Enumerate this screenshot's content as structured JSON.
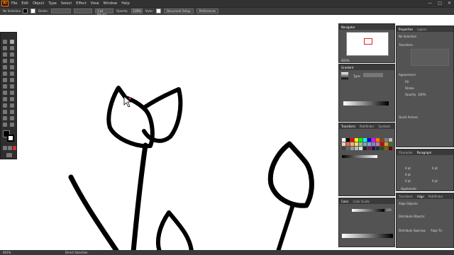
{
  "app": {
    "logo_text": "Ai"
  },
  "menubar": {
    "items": [
      "File",
      "Edit",
      "Object",
      "Type",
      "Select",
      "Effect",
      "View",
      "Window",
      "Help"
    ]
  },
  "window_controls": {
    "minimize": "—",
    "maximize": "□",
    "close": "✕"
  },
  "control_bar": {
    "selection_label": "No Selection",
    "stroke_label": "Stroke:",
    "brush_value": "3 pt. Round",
    "opacity_label": "Opacity:",
    "opacity_value": "100%",
    "style_label": "Style:",
    "document_setup": "Document Setup",
    "preferences": "Preferences"
  },
  "navigator": {
    "tabs": [
      "Navigator"
    ],
    "zoom": "401%"
  },
  "gradient": {
    "tabs": [
      "Gradient"
    ],
    "type_label": "Type:"
  },
  "swatches": {
    "tabs": [
      "Transform",
      "Pathfinder",
      "Symbols"
    ]
  },
  "color": {
    "tabs": [
      "Color",
      "Color Guide"
    ],
    "value": "100"
  },
  "properties": {
    "tabs": [
      "Properties",
      "Layers"
    ],
    "no_selection": "No Selection",
    "transform_label": "Transform",
    "appearance_label": "Appearance",
    "fill_label": "Fill",
    "stroke_label": "Stroke",
    "opacity_label": "Opacity",
    "opacity_value": "100%",
    "quick_actions": "Quick Actions"
  },
  "paragraph": {
    "tabs": [
      "Character",
      "Paragraph"
    ],
    "values": [
      "0 pt",
      "0 pt",
      "0 pt",
      "0 pt",
      "0 pt"
    ],
    "hyphenate": "Hyphenate"
  },
  "align": {
    "tabs": [
      "Transform",
      "Align",
      "Pathfinder"
    ],
    "align_objects": "Align Objects:",
    "distribute_objects": "Distribute Objects:",
    "distribute_spacing": "Distribute Spacing:",
    "align_to": "Align To:"
  },
  "status": {
    "zoom": "401%",
    "tool": "Direct Selection"
  },
  "colors": {
    "menubar": "#323232",
    "panel": "#535353",
    "accent": "#ff7c00"
  },
  "swatch_colors": [
    "#ffffff",
    "#000000",
    "#ff0000",
    "#ffff00",
    "#00ff00",
    "#00ffff",
    "#0000ff",
    "#ff00ff",
    "#ff7c00",
    "#8b4513",
    "#808080",
    "#c0c0c0",
    "#f5d0a9",
    "#e06666",
    "#f6b26b",
    "#ffd966",
    "#93c47d",
    "#76a5af",
    "#6fa8dc",
    "#8e7cc3",
    "#c27ba0",
    "#cc0000",
    "#e69138",
    "#38761d",
    "#444444",
    "#666666",
    "#999999",
    "#bbbbbb",
    "#dddddd",
    "#222222",
    "#741b47",
    "#20124d",
    "#0c343d",
    "#274e13",
    "#7f6000",
    "#660000"
  ]
}
